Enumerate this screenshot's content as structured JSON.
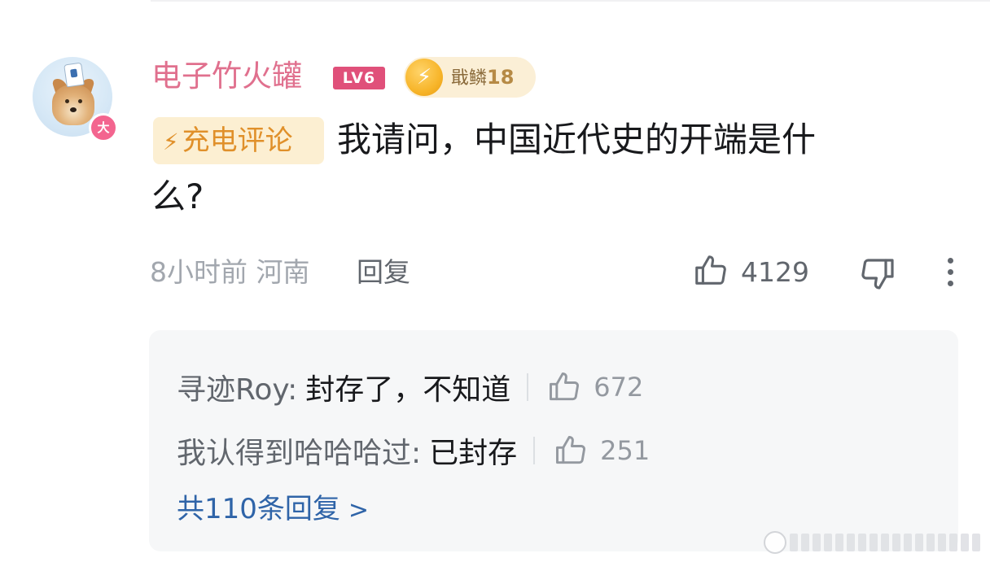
{
  "comment": {
    "username": "电子竹火罐",
    "level_badge": "LV6",
    "vip_badge": "大",
    "medal": {
      "name": "戢鳞",
      "level": "18"
    },
    "charge_tag": "充电评论",
    "text_line1": "我请问，中国近代史的开端是什",
    "text_line2": "么?",
    "time": "8小时前",
    "location": "河南",
    "reply_label": "回复",
    "like_count": "4129"
  },
  "replies": {
    "items": [
      {
        "user": "寻迹Roy:",
        "text": "封存了，不知道",
        "likes": "672"
      },
      {
        "user": "我认得到哈哈哈过:",
        "text": "已封存",
        "likes": "251"
      }
    ],
    "more_label": "共110条回复",
    "more_chevron": ">"
  },
  "icons": {
    "like": "thumbs-up-icon",
    "dislike": "thumbs-down-icon",
    "more": "more-vertical-icon",
    "bolt": "lightning-icon"
  },
  "colors": {
    "username": "#e0708e",
    "level_badge": "#e0507a",
    "charge_tag_bg": "#fcefd2",
    "charge_tag_text": "#e0902a",
    "link": "#2f64a8",
    "reply_box_bg": "#f6f7f8"
  }
}
